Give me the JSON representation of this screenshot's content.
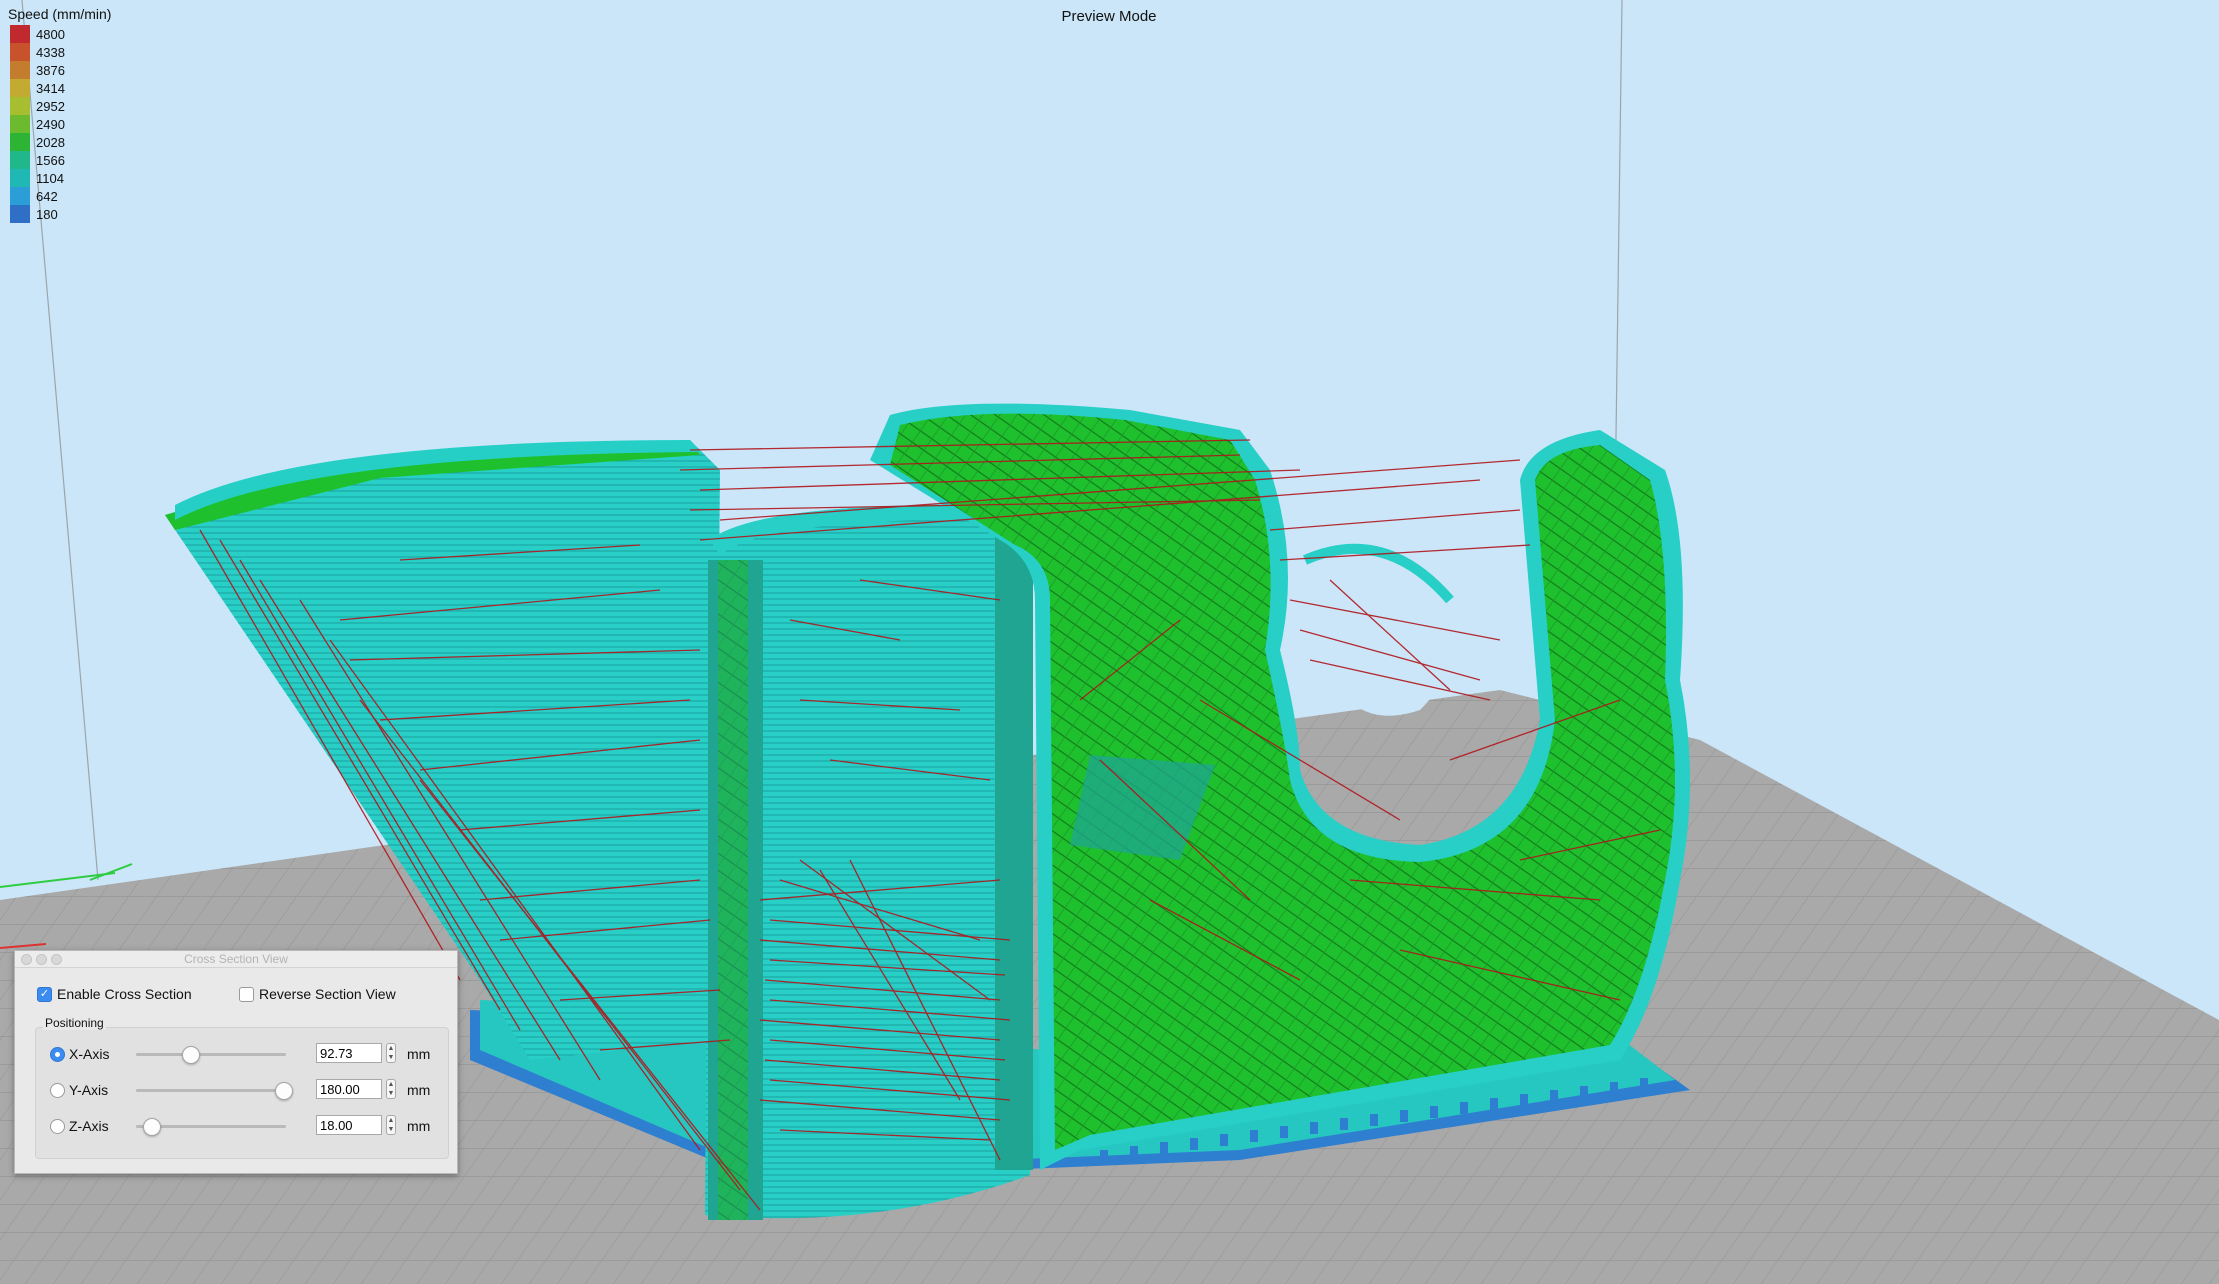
{
  "window": {
    "mode_title": "Preview Mode"
  },
  "legend": {
    "title": "Speed (mm/min)",
    "entries": [
      {
        "value": "4800",
        "color": "#c0292d"
      },
      {
        "value": "4338",
        "color": "#c8522c"
      },
      {
        "value": "3876",
        "color": "#c47c2e"
      },
      {
        "value": "3414",
        "color": "#c3aa31"
      },
      {
        "value": "2952",
        "color": "#a7be31"
      },
      {
        "value": "2490",
        "color": "#6cbb2e"
      },
      {
        "value": "2028",
        "color": "#2eb434"
      },
      {
        "value": "1566",
        "color": "#20b78a"
      },
      {
        "value": "1104",
        "color": "#1fb8b4"
      },
      {
        "value": "642",
        "color": "#2b9ed8"
      },
      {
        "value": "180",
        "color": "#2f6fc5"
      }
    ]
  },
  "colors": {
    "sky": "#cbe6f8",
    "bed": "#a9a9a9",
    "shell": "#26cfc6",
    "infill": "#1ebf2f",
    "travel": "#b0161c",
    "base": "#2f7fd0"
  },
  "cross_section": {
    "window_title": "Cross Section View",
    "enable_label": "Enable Cross Section",
    "enable_checked": true,
    "reverse_label": "Reverse Section View",
    "reverse_checked": false,
    "group_label": "Positioning",
    "axes": [
      {
        "label": "X-Axis",
        "value": "92.73",
        "unit": "mm",
        "selected": true,
        "slider_fraction": 0.36
      },
      {
        "label": "Y-Axis",
        "value": "180.00",
        "unit": "mm",
        "selected": false,
        "slider_fraction": 0.98
      },
      {
        "label": "Z-Axis",
        "value": "18.00",
        "unit": "mm",
        "selected": false,
        "slider_fraction": 0.1
      }
    ]
  }
}
